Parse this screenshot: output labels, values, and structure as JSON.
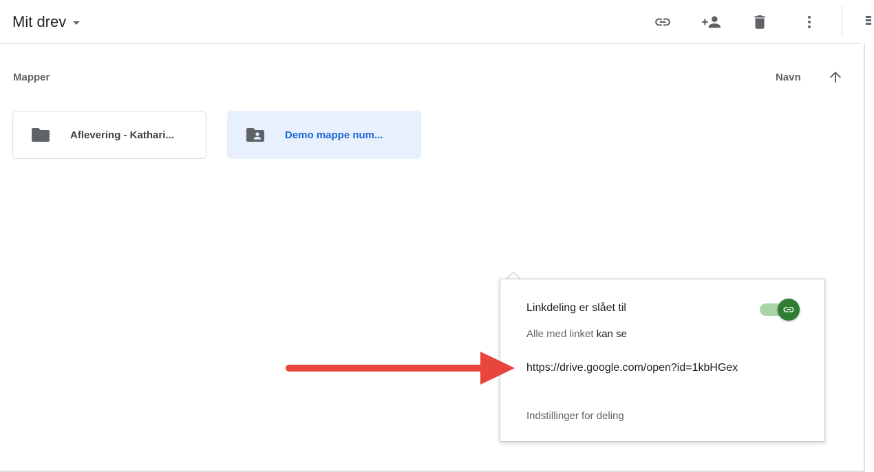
{
  "header": {
    "title": "Mit drev",
    "icons": [
      "link-icon",
      "add-person-icon",
      "trash-icon",
      "more-vert-icon",
      "details-icon"
    ]
  },
  "section": {
    "label": "Mapper",
    "sort_label": "Navn",
    "sort_direction": "ascending"
  },
  "folders": [
    {
      "name": "Aflevering - Kathari...",
      "icon": "folder-icon",
      "selected": false
    },
    {
      "name": "Demo mappe num...",
      "icon": "shared-folder-icon",
      "selected": true
    }
  ],
  "share_popup": {
    "title": "Linkdeling er slået til",
    "subtitle_prefix": "Alle med linket",
    "subtitle_permission": "kan se",
    "link": "https://drive.google.com/open?id=1kbHGex",
    "settings_label": "Indstillinger for deling",
    "toggle_on": true
  },
  "annotation": {
    "arrow_color": "#e8453c"
  },
  "colors": {
    "accent_blue": "#1967d2",
    "selected_bg": "#e8f0fe",
    "toggle_on": "#2e7d32",
    "icon_gray": "#5f6368"
  }
}
